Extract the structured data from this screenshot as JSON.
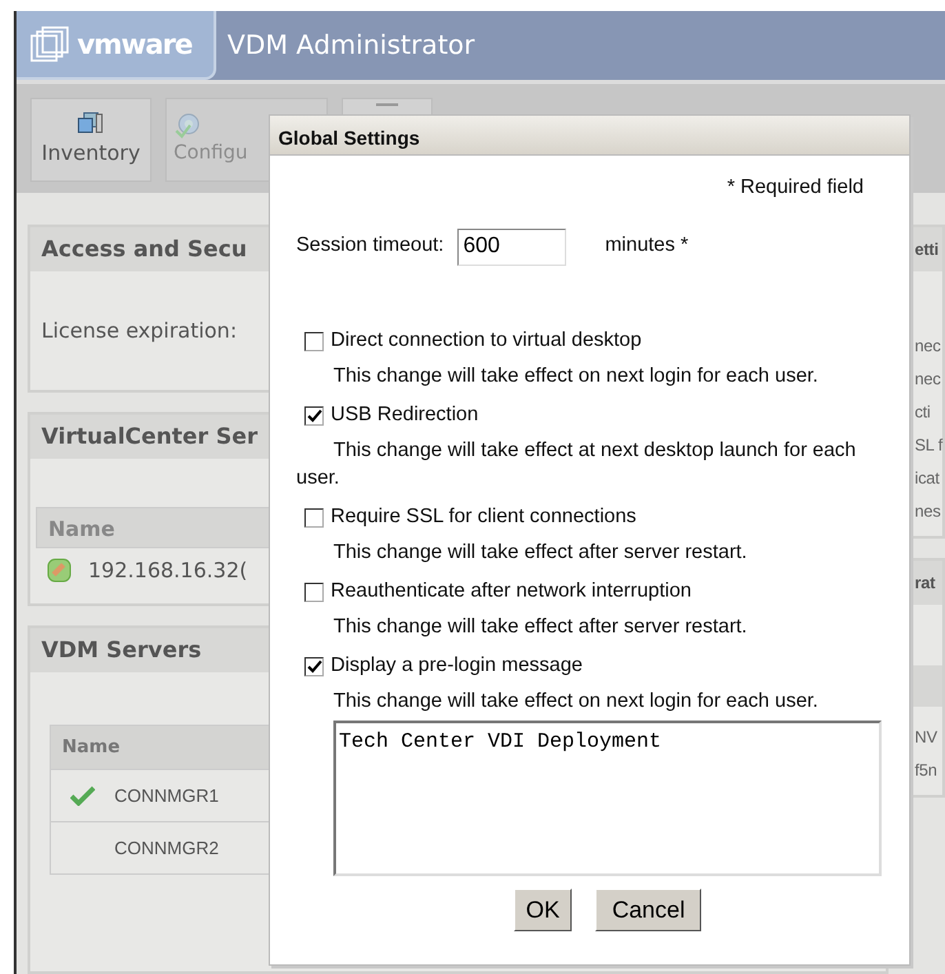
{
  "header": {
    "logo": "vmware",
    "title": "VDM Administrator"
  },
  "toolbar": [
    {
      "label": "Inventory",
      "enabled": true
    },
    {
      "label": "Configu",
      "enabled": false
    }
  ],
  "access_panel": {
    "title": "Access and Secu",
    "label": "License expiration:"
  },
  "virtualcenter_panel": {
    "title": "VirtualCenter Ser",
    "column": "Name",
    "rows": [
      "192.168.16.32("
    ]
  },
  "vdm_servers_panel": {
    "title": "VDM Servers",
    "column": "Name",
    "rows": [
      {
        "name": "CONNMGR1",
        "ok": true
      },
      {
        "name": "CONNMGR2",
        "ok": false
      }
    ]
  },
  "right_panels": [
    {
      "title": "etti",
      "lines": [
        "nec",
        "nec",
        "cti",
        "SL f",
        "icat",
        "nes"
      ]
    },
    {
      "title": "rat",
      "lines": [
        "NV",
        "f5n"
      ]
    }
  ],
  "dialog": {
    "title": "Global Settings",
    "required_note": "* Required field",
    "session_timeout": {
      "label": "Session timeout:",
      "value": "600",
      "unit": "minutes *"
    },
    "options": [
      {
        "label": "Direct connection to virtual desktop",
        "checked": false,
        "note": "This change will take effect on next login for each user."
      },
      {
        "label": "USB Redirection",
        "checked": true,
        "note": "This change will take effect at next desktop launch for each user."
      },
      {
        "label": "Require SSL for client connections",
        "checked": false,
        "note": "This change will take effect after server restart."
      },
      {
        "label": "Reauthenticate after network interruption",
        "checked": false,
        "note": "This change will take effect after server restart."
      },
      {
        "label": "Display a pre-login message",
        "checked": true,
        "note": "This change will take effect on next login for each user."
      }
    ],
    "message": "Tech Center VDI Deployment",
    "buttons": [
      "OK",
      "Cancel"
    ]
  }
}
